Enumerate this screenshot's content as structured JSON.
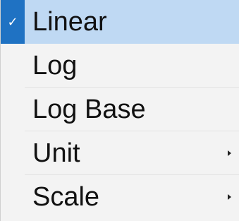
{
  "menu": {
    "items": [
      {
        "label": "Linear",
        "checked": true,
        "submenu": false,
        "icon": "checkmark-icon"
      },
      {
        "label": "Log",
        "checked": false,
        "submenu": false
      },
      {
        "label": "Log Base",
        "checked": false,
        "submenu": false
      },
      {
        "label": "Unit",
        "checked": false,
        "submenu": true,
        "icon": "submenu-arrow-icon"
      },
      {
        "label": "Scale",
        "checked": false,
        "submenu": true,
        "icon": "submenu-arrow-icon"
      }
    ],
    "colors": {
      "selected_background": "#bfd9f3",
      "check_background": "#1f72c3",
      "menu_background": "#f3f3f3",
      "text": "#111111"
    }
  }
}
